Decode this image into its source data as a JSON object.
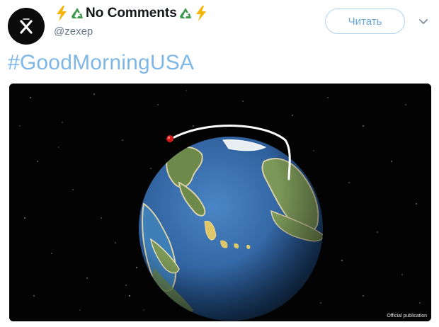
{
  "tweet": {
    "display_name": "No Comments",
    "handle": "@zexep",
    "follow_label": "Читать",
    "hashtag": "#GoodMorningUSA",
    "name_emoji_left": [
      "lightning-emoji",
      "recycling-emoji"
    ],
    "name_emoji_right": [
      "recycling-emoji",
      "lightning-emoji"
    ]
  },
  "media": {
    "watermark": "Official publication",
    "description_icons": [
      "globe-image",
      "trajectory-arc",
      "red-marker"
    ]
  },
  "colors": {
    "link": "#7fb8e6",
    "follow_border": "#b1d4ee",
    "follow_text": "#6aa9d9",
    "handle": "#657786",
    "ocean": "#2e5f9c",
    "land": "#6e8a4a",
    "marker": "#d61a1a"
  }
}
